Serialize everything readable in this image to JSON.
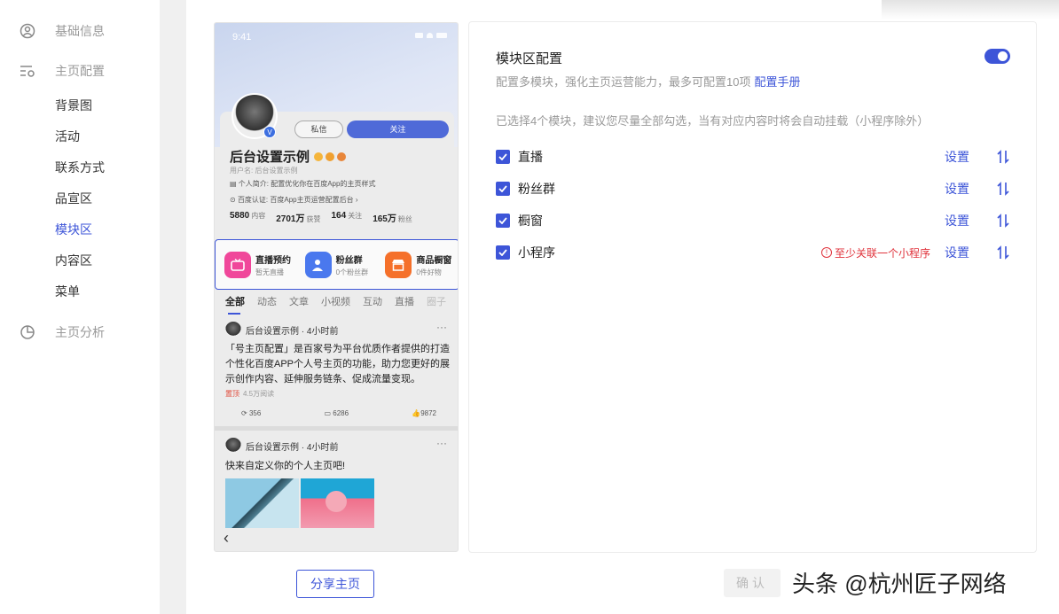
{
  "sidebar": {
    "groups": [
      {
        "label": "基础信息",
        "icon": "user-circle-icon"
      },
      {
        "label": "主页配置",
        "icon": "list-settings-icon"
      },
      {
        "label": "主页分析",
        "icon": "pie-chart-icon"
      }
    ],
    "items": [
      {
        "label": "背景图"
      },
      {
        "label": "活动"
      },
      {
        "label": "联系方式"
      },
      {
        "label": "品宣区"
      },
      {
        "label": "模块区",
        "active": true
      },
      {
        "label": "内容区"
      },
      {
        "label": "菜单"
      }
    ]
  },
  "phone": {
    "time": "9:41",
    "msg_btn": "私信",
    "follow_btn": "关注",
    "name": "后台设置示例",
    "username": "用户名: 后台设置示例",
    "intro": "个人简介: 配置优化你在百度App的主页样式",
    "cert": "百度认证: 百度App主页运营配置后台",
    "stats": [
      {
        "num": "5880",
        "unit": "内容"
      },
      {
        "num": "2701万",
        "unit": "获赞"
      },
      {
        "num": "164",
        "unit": "关注"
      },
      {
        "num": "165万",
        "unit": "粉丝"
      }
    ],
    "modules": [
      {
        "title": "直播预约",
        "sub": "暂无直播",
        "color": "#f0479a",
        "icon": "tv-icon"
      },
      {
        "title": "粉丝群",
        "sub": "0个粉丝群",
        "color": "#4a78ee",
        "icon": "person-group-icon"
      },
      {
        "title": "商品橱窗",
        "sub": "0件好物",
        "color": "#f5702a",
        "icon": "shop-icon"
      }
    ],
    "tabs": [
      "全部",
      "动态",
      "文章",
      "小视频",
      "互动",
      "直播",
      "圈子"
    ],
    "post1": {
      "author": "后台设置示例 · 4小时前",
      "text": "「号主页配置」是百家号为平台优质作者提供的打造个性化百度APP个人号主页的功能，助力您更好的展示创作内容、延伸服务链条、促成流量变现。",
      "top": "置顶",
      "reads": "4.5万阅读",
      "shares": "356",
      "comments": "6286",
      "likes": "9872"
    },
    "post2": {
      "author": "后台设置示例 · 4小时前",
      "text": "快来自定义你的个人主页吧!"
    }
  },
  "share_button": "分享主页",
  "panel": {
    "title": "模块区配置",
    "toggle_on": true,
    "desc": "配置多模块，强化主页运营能力，最多可配置10项",
    "manual_link": "配置手册",
    "hint": "已选择4个模块，建议您尽量全部勾选，当有对应内容时将会自动挂载（小程序除外）",
    "rows": [
      {
        "label": "直播",
        "checked": true,
        "warning": "",
        "set": "设置"
      },
      {
        "label": "粉丝群",
        "checked": true,
        "warning": "",
        "set": "设置"
      },
      {
        "label": "橱窗",
        "checked": true,
        "warning": "",
        "set": "设置"
      },
      {
        "label": "小程序",
        "checked": true,
        "warning": "至少关联一个小程序",
        "set": "设置"
      }
    ]
  },
  "confirm_button": "确认",
  "watermark": "头条 @杭州匠子网络",
  "colors": {
    "accent": "#3d55d8",
    "warning": "#e0333c"
  }
}
